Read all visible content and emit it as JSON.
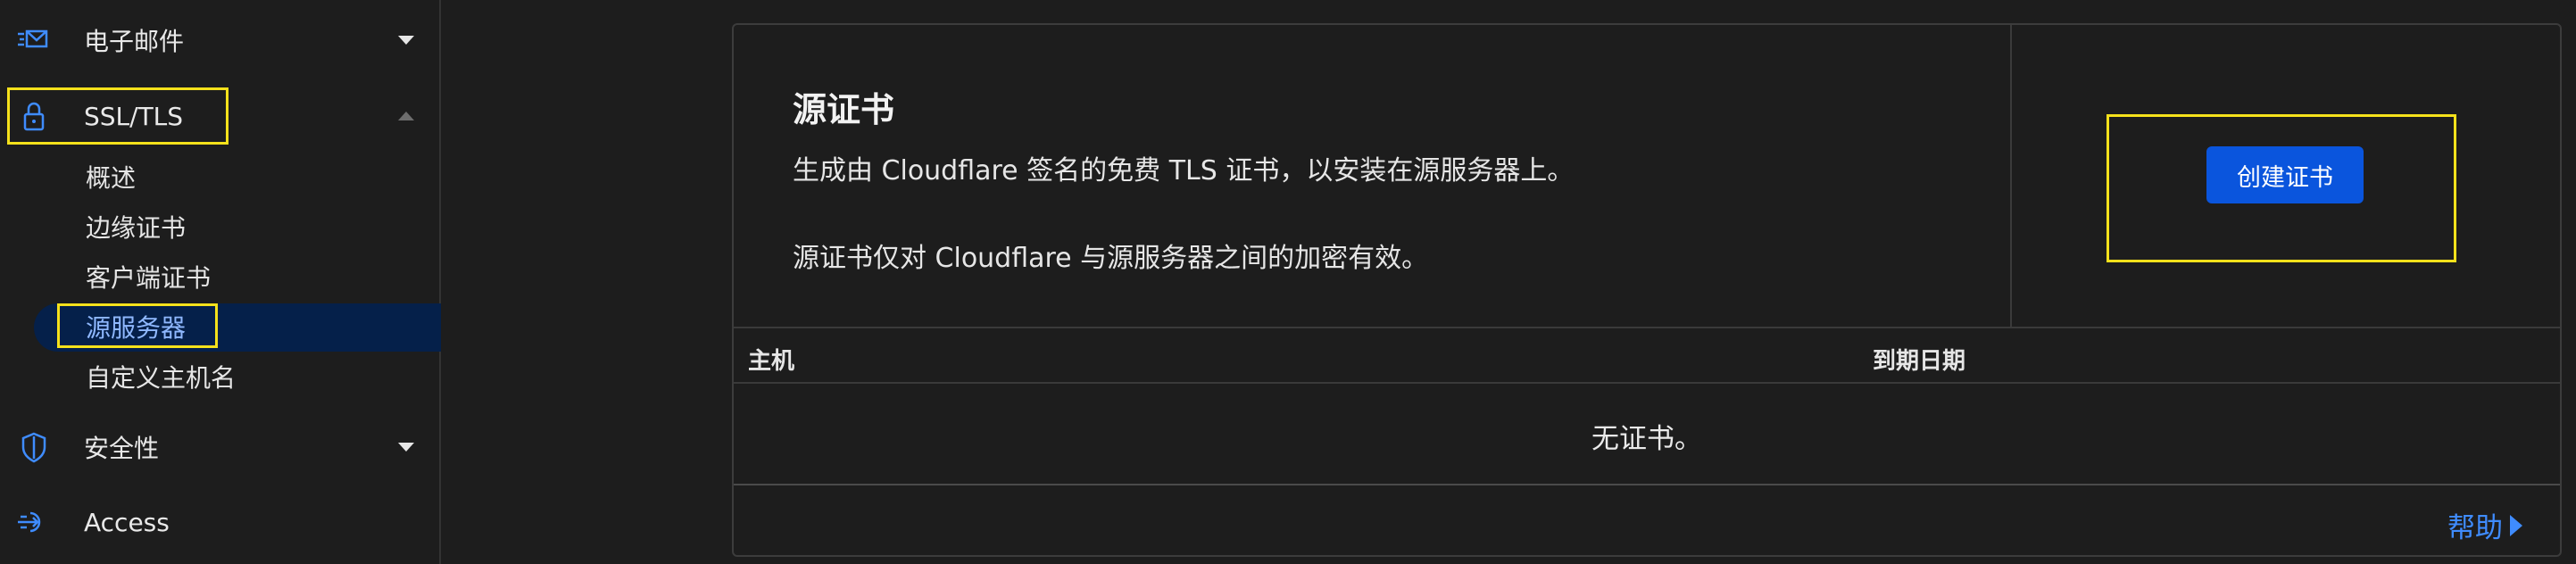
{
  "sidebar": {
    "email": {
      "label": "电子邮件",
      "icon": "mail-icon"
    },
    "ssl_tls": {
      "label": "SSL/TLS",
      "icon": "lock-icon",
      "subitems": [
        "概述",
        "边缘证书",
        "客户端证书",
        "源服务器",
        "自定义主机名"
      ],
      "active_index": 3
    },
    "security": {
      "label": "安全性",
      "icon": "shield-icon"
    },
    "access": {
      "label": "Access",
      "icon": "access-icon"
    }
  },
  "card": {
    "title": "源证书",
    "desc1": "生成由 Cloudflare 签名的免费 TLS 证书，以安装在源服务器上。",
    "desc2": "源证书仅对 Cloudflare 与源服务器之间的加密有效。",
    "create_button": "创建证书",
    "columns": {
      "host": "主机",
      "expiry": "到期日期"
    },
    "empty_text": "无证书。",
    "help": "帮助"
  },
  "colors": {
    "accent": "#0a55dd",
    "link": "#3f8cff",
    "highlight": "#f5e11b",
    "active_bg": "#05204a"
  }
}
